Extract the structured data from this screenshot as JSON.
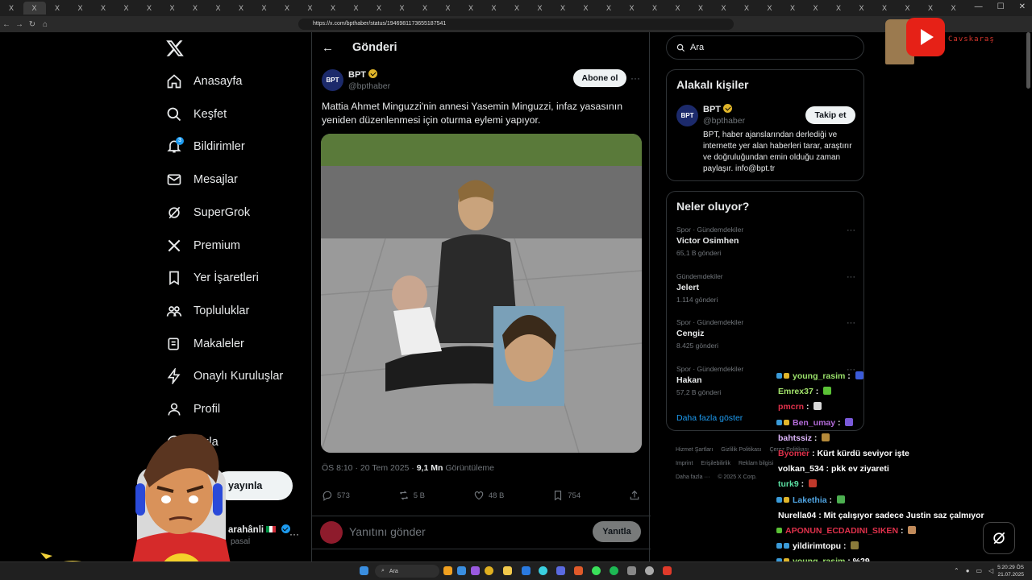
{
  "browser": {
    "url": "https://x.com/bpthaber/status/1946981173655187541",
    "tab_x_label": "X"
  },
  "nav": {
    "items": [
      {
        "label": "Anasayfa",
        "icon": "home-icon"
      },
      {
        "label": "Keşfet",
        "icon": "search-icon"
      },
      {
        "label": "Bildirimler",
        "icon": "bell-icon",
        "badge": "3"
      },
      {
        "label": "Mesajlar",
        "icon": "mail-icon"
      },
      {
        "label": "SuperGrok",
        "icon": "grok-icon"
      },
      {
        "label": "Premium",
        "icon": "x-icon"
      },
      {
        "label": "Yer İşaretleri",
        "icon": "bookmark-icon"
      },
      {
        "label": "Topluluklar",
        "icon": "people-icon"
      },
      {
        "label": "Makaleler",
        "icon": "article-icon"
      },
      {
        "label": "Onaylı Kuruluşlar",
        "icon": "lightning-icon"
      },
      {
        "label": "Profil",
        "icon": "person-icon"
      },
      {
        "label": "fazla",
        "icon": "more-icon"
      }
    ],
    "post_button": "yayınla",
    "account_name": "arahânli",
    "account_handle": "pasaİ"
  },
  "header": {
    "title": "Gönderi"
  },
  "tweet": {
    "author": "BPT",
    "handle": "@bpthaber",
    "avatar_text": "BPT",
    "follow_label": "Abone ol",
    "text": "Mattia Ahmet Minguzzi'nin annesi Yasemin Minguzzi, infaz yasasının yeniden düzenlenmesi için oturma eylemi yapıyor.",
    "time": "ÖS 8:10 · 20 Tem 2025 · ",
    "views_num": "9,1 Mn",
    "views_label": " Görüntüleme",
    "replies": "573",
    "reposts": "5 B",
    "likes": "48 B",
    "bookmarks": "754"
  },
  "reply": {
    "placeholder": "Yanıtını gönder",
    "button": "Yanıtla"
  },
  "search": {
    "placeholder": "Ara"
  },
  "related": {
    "title": "Alakalı kişiler",
    "name": "BPT",
    "handle": "@bpthaber",
    "follow_label": "Takip et",
    "bio": "BPT, haber ajanslarından derlediği ve internette yer alan haberleri tarar, araştırır ve doğruluğundan emin olduğu zaman paylaşır. info@bpt.tr"
  },
  "trends": {
    "title": "Neler oluyor?",
    "items": [
      {
        "category": "Spor · Gündemdekiler",
        "name": "Victor Osimhen",
        "count": "65,1 B gönderi"
      },
      {
        "category": "Gündemdekiler",
        "name": "Jelert",
        "count": "1.114 gönderi"
      },
      {
        "category": "Spor · Gündemdekiler",
        "name": "Cengiz",
        "count": "8.425 gönderi"
      },
      {
        "category": "Spor · Gündemdekiler",
        "name": "Hakan",
        "count": "57,2 B gönderi"
      }
    ],
    "show_more": "Daha fazla göster"
  },
  "footer": {
    "links": [
      "Hizmet Şartları",
      "Gizlilik Politikası",
      "Çerez Politikası",
      "Imprint",
      "Erişilebilirlik",
      "Reklam bilgisi",
      "Daha fazla ···",
      "© 2025 X Corp."
    ]
  },
  "chat": [
    {
      "user": "young_rasim",
      "color": "#9be26b",
      "text": "",
      "badges": [
        "#3a9bd9",
        "#e0b52a"
      ],
      "emoji": "#3b5bd9"
    },
    {
      "user": "Emrex37",
      "color": "#a3e36b",
      "text": "",
      "badges": [],
      "emoji": "#5bc236"
    },
    {
      "user": "pmcrn",
      "color": "#e0314b",
      "text": "",
      "badges": [],
      "emoji": "#d9d9d9"
    },
    {
      "user": "Ben_umay",
      "color": "#b36bd9",
      "text": "",
      "badges": [
        "#3a9bd9",
        "#e0b52a"
      ],
      "emoji": "#7a5ad9"
    },
    {
      "user": "bahtssiz",
      "color": "#e0b8ff",
      "text": "",
      "badges": [],
      "emoji": "#b58a3a"
    },
    {
      "user": "Byomer",
      "color": "#e0314b",
      "text": "Kürt kürdü seviyor işte",
      "badges": [],
      "emoji": ""
    },
    {
      "user": "volkan_534",
      "color": "#ffffff",
      "text": "pkk ev ziyareti",
      "badges": [],
      "emoji": ""
    },
    {
      "user": "turk9",
      "color": "#5be0a3",
      "text": "",
      "badges": [],
      "emoji": "#c0392b"
    },
    {
      "user": "Lakethia",
      "color": "#4fa3e0",
      "text": "",
      "badges": [
        "#3a9bd9",
        "#e0b52a"
      ],
      "emoji": "#4caf50"
    },
    {
      "user": "Nurella04",
      "color": "#ffffff",
      "text": "Mit çalışıyor sadece Justin saz çalmıyor",
      "badges": [],
      "emoji": ""
    },
    {
      "user": "APONUN_ECDADINI_SIKEN",
      "color": "#e0314b",
      "text": "",
      "badges": [
        "#5bc236"
      ],
      "emoji": "#c08a5a"
    },
    {
      "user": "yildirimtopu",
      "color": "#ffffff",
      "text": "",
      "badges": [
        "#3a9bd9",
        "#3a9bd9"
      ],
      "emoji": "#8a7a3a"
    },
    {
      "user": "young_rasim",
      "color": "#9be26b",
      "text": "%29",
      "badges": [
        "#3a9bd9",
        "#e0b52a"
      ],
      "emoji": ""
    }
  ],
  "overlay": {
    "stream_name": "Cavskaraş"
  },
  "taskbar": {
    "search": "Ara",
    "time": "5:20:29 ÖS",
    "date": "21.07.2025"
  }
}
